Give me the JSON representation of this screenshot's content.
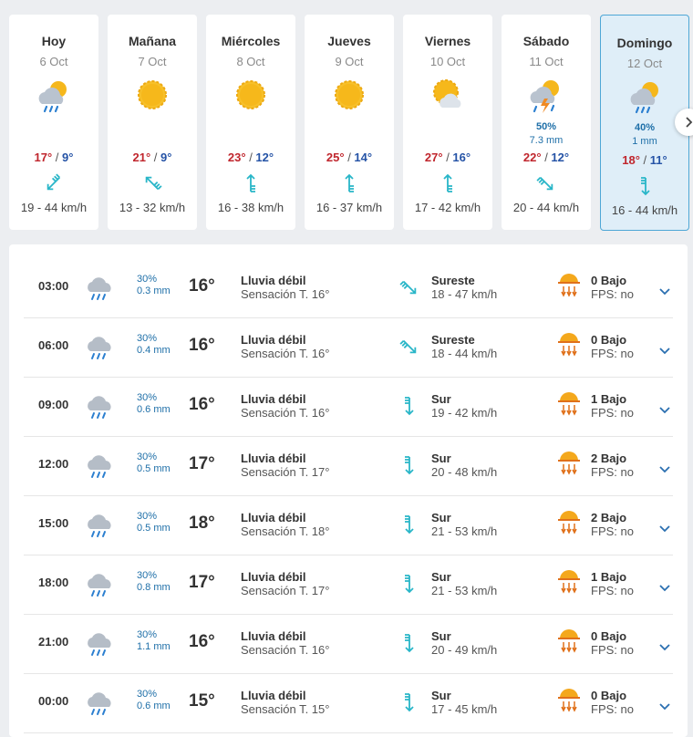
{
  "days": [
    {
      "name": "Hoy",
      "date": "6 Oct",
      "icon": "sun-cloud-rain-icon",
      "tmax": "17°",
      "tmin": "9°",
      "wind": "19 - 44 km/h",
      "wind_dir": 225
    },
    {
      "name": "Mañana",
      "date": "7 Oct",
      "icon": "sun-icon",
      "tmax": "21°",
      "tmin": "9°",
      "wind": "13 - 32 km/h",
      "wind_dir": 315
    },
    {
      "name": "Miércoles",
      "date": "8 Oct",
      "icon": "sun-icon",
      "tmax": "23°",
      "tmin": "12°",
      "wind": "16 - 38 km/h",
      "wind_dir": 0
    },
    {
      "name": "Jueves",
      "date": "9 Oct",
      "icon": "sun-icon",
      "tmax": "25°",
      "tmin": "14°",
      "wind": "16 - 37 km/h",
      "wind_dir": 0
    },
    {
      "name": "Viernes",
      "date": "10 Oct",
      "icon": "sun-cloud-icon",
      "tmax": "27°",
      "tmin": "16°",
      "wind": "17 - 42 km/h",
      "wind_dir": 0
    },
    {
      "name": "Sábado",
      "date": "11 Oct",
      "icon": "storm-icon",
      "precip_prob": "50%",
      "precip_mm": "7.3 mm",
      "tmax": "22°",
      "tmin": "12°",
      "wind": "20 - 44 km/h",
      "wind_dir": 135
    },
    {
      "name": "Domingo",
      "date": "12 Oct",
      "icon": "sun-cloud-rain-icon",
      "precip_prob": "40%",
      "precip_mm": "1 mm",
      "tmax": "18°",
      "tmin": "11°",
      "wind": "16 - 44 km/h",
      "wind_dir": 180,
      "selected": true
    }
  ],
  "hours": [
    {
      "time": "03:00",
      "prob": "30%",
      "mm": "0.3 mm",
      "temp": "16°",
      "cond": "Lluvia débil",
      "feels": "Sensación T. 16°",
      "wind_name": "Sureste",
      "wind_speed": "18 - 47 km/h",
      "wind_dir": 135,
      "uv": "0 Bajo",
      "fps": "FPS: no"
    },
    {
      "time": "06:00",
      "prob": "30%",
      "mm": "0.4 mm",
      "temp": "16°",
      "cond": "Lluvia débil",
      "feels": "Sensación T. 16°",
      "wind_name": "Sureste",
      "wind_speed": "18 - 44 km/h",
      "wind_dir": 135,
      "uv": "0 Bajo",
      "fps": "FPS: no"
    },
    {
      "time": "09:00",
      "prob": "30%",
      "mm": "0.6 mm",
      "temp": "16°",
      "cond": "Lluvia débil",
      "feels": "Sensación T. 16°",
      "wind_name": "Sur",
      "wind_speed": "19 - 42 km/h",
      "wind_dir": 180,
      "uv": "1 Bajo",
      "fps": "FPS: no"
    },
    {
      "time": "12:00",
      "prob": "30%",
      "mm": "0.5 mm",
      "temp": "17°",
      "cond": "Lluvia débil",
      "feels": "Sensación T. 17°",
      "wind_name": "Sur",
      "wind_speed": "20 - 48 km/h",
      "wind_dir": 180,
      "uv": "2 Bajo",
      "fps": "FPS: no"
    },
    {
      "time": "15:00",
      "prob": "30%",
      "mm": "0.5 mm",
      "temp": "18°",
      "cond": "Lluvia débil",
      "feels": "Sensación T. 18°",
      "wind_name": "Sur",
      "wind_speed": "21 - 53 km/h",
      "wind_dir": 180,
      "uv": "2 Bajo",
      "fps": "FPS: no"
    },
    {
      "time": "18:00",
      "prob": "30%",
      "mm": "0.8 mm",
      "temp": "17°",
      "cond": "Lluvia débil",
      "feels": "Sensación T. 17°",
      "wind_name": "Sur",
      "wind_speed": "21 - 53 km/h",
      "wind_dir": 180,
      "uv": "1 Bajo",
      "fps": "FPS: no"
    },
    {
      "time": "21:00",
      "prob": "30%",
      "mm": "1.1 mm",
      "temp": "16°",
      "cond": "Lluvia débil",
      "feels": "Sensación T. 16°",
      "wind_name": "Sur",
      "wind_speed": "20 - 49 km/h",
      "wind_dir": 180,
      "uv": "0 Bajo",
      "fps": "FPS: no"
    },
    {
      "time": "00:00",
      "prob": "30%",
      "mm": "0.6 mm",
      "temp": "15°",
      "cond": "Lluvia débil",
      "feels": "Sensación T. 15°",
      "wind_name": "Sur",
      "wind_speed": "17 - 45 km/h",
      "wind_dir": 180,
      "uv": "0 Bajo",
      "fps": "FPS: no"
    }
  ],
  "colors": {
    "max": "#c0262d",
    "min": "#2553a6",
    "wind": "#29b6c8",
    "precip": "#1e6fa8",
    "selected_bg": "#dfeef8",
    "selected_border": "#4ea7d6"
  },
  "next_icon": "chevron-right-icon"
}
